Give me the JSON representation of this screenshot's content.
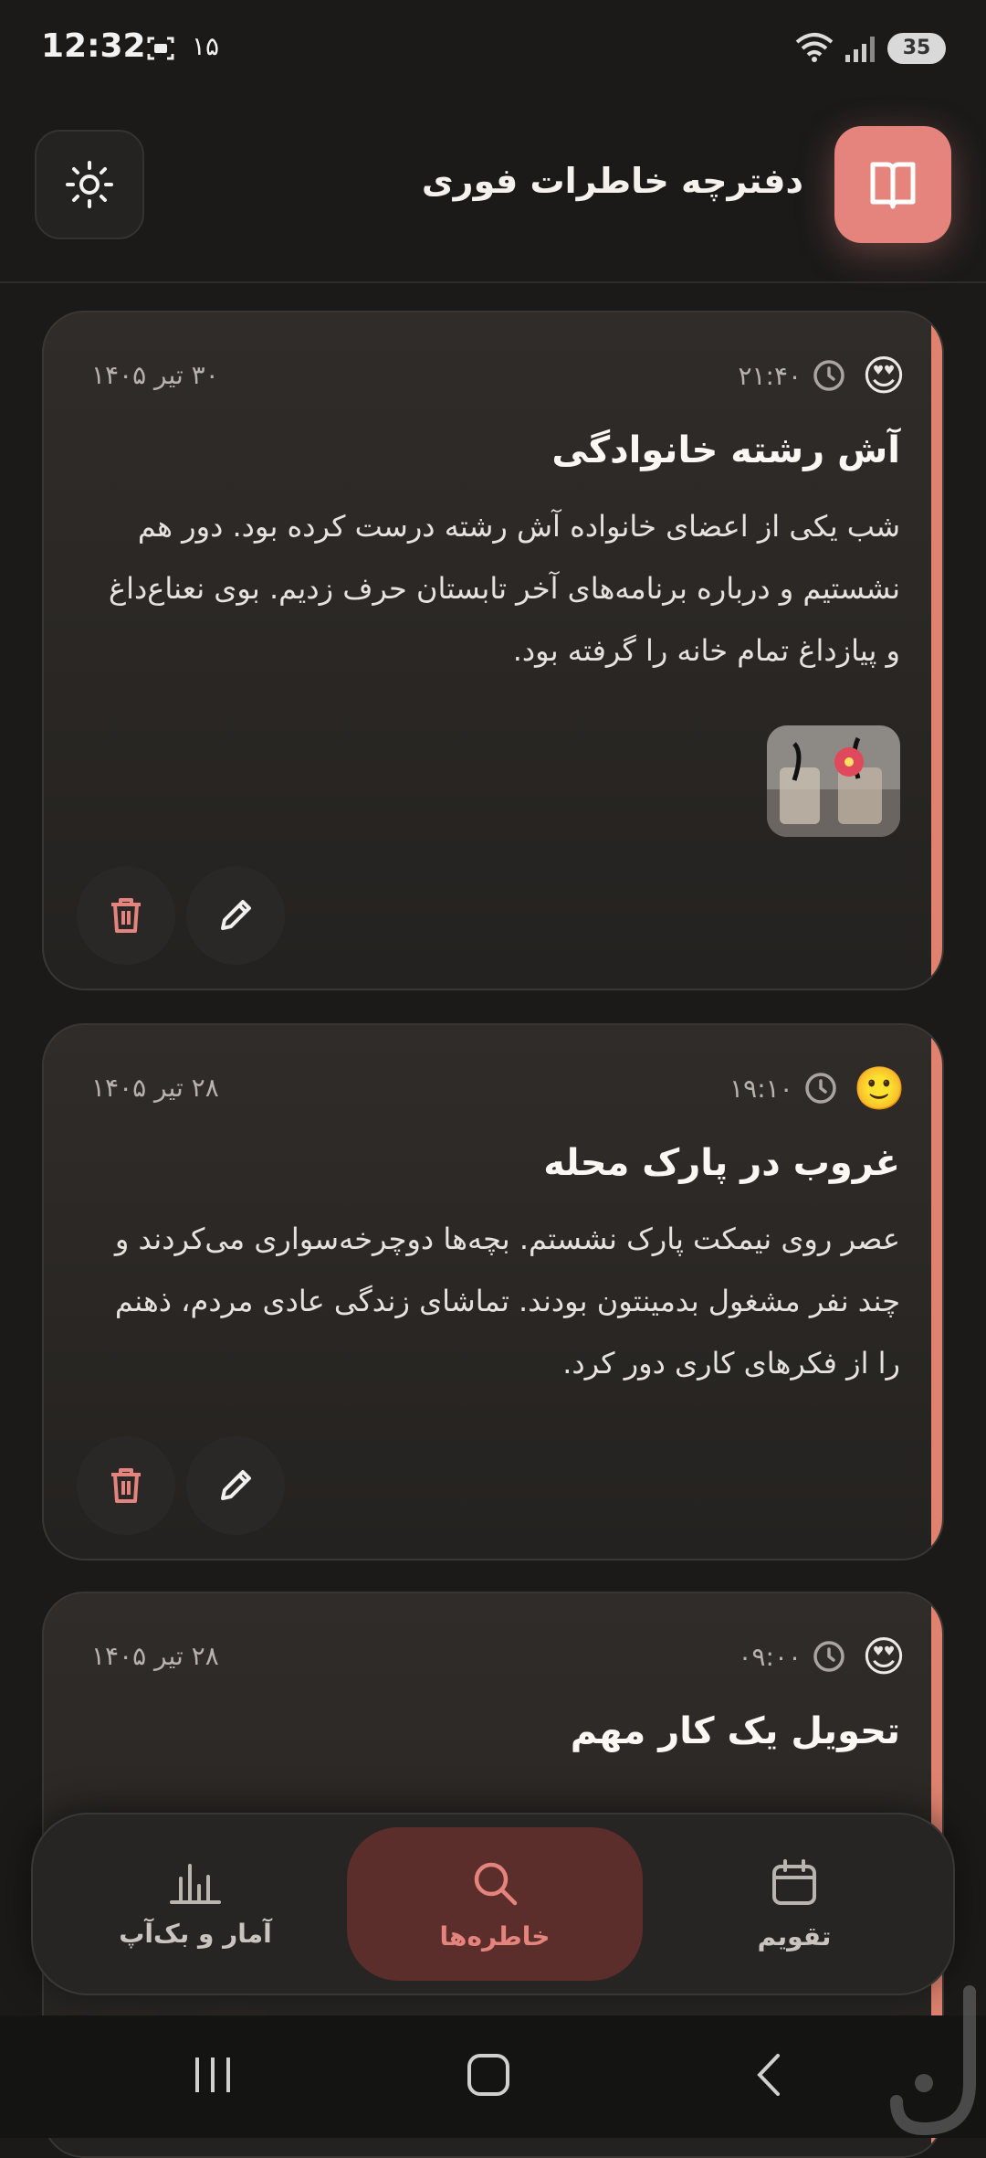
{
  "status_bar": {
    "time": "12:32",
    "notification_count": "۱۵",
    "battery": "35"
  },
  "header": {
    "title": "دفترچه خاطرات فوری",
    "theme_icon": "sun-icon",
    "logo_icon": "book-open-icon"
  },
  "colors": {
    "accent": "#e4847d",
    "card_stripe": "#e0826f",
    "nav_active_bg": "#5b2e2b",
    "background": "#1b1a19"
  },
  "entries": [
    {
      "date": "۳۰ تیر ۱۴۰۵",
      "time": "۲۱:۴۰",
      "mood": "😍",
      "title": "آش رشته خانوادگی",
      "body": "شب یکی از اعضای خانواده آش رشته درست کرده بود. دور هم نشستیم و درباره برنامه‌های آخر تابستان حرف زدیم. بوی نعناع‌داغ و پیازداغ تمام خانه را گرفته بود.",
      "has_photo": true
    },
    {
      "date": "۲۸ تیر ۱۴۰۵",
      "time": "۱۹:۱۰",
      "mood": "🙂",
      "title": "غروب در پارک محله",
      "body": "عصر روی نیمکت پارک نشستم. بچه‌ها دوچرخه‌سواری می‌کردند و چند نفر مشغول بدمینتون بودند. تماشای زندگی عادی مردم، ذهنم را از فکرهای کاری دور کرد.",
      "has_photo": false
    },
    {
      "date": "۲۸ تیر ۱۴۰۵",
      "time": "۰۹:۰۰",
      "mood": "😍",
      "title": "تحویل یک کار مهم",
      "body": "",
      "has_photo": false
    }
  ],
  "bottom_nav": {
    "items": [
      {
        "label": "آمار و بک‌آپ",
        "icon": "bar-chart-icon",
        "active": false
      },
      {
        "label": "خاطره‌ها",
        "icon": "search-icon",
        "active": true
      },
      {
        "label": "تقویم",
        "icon": "calendar-icon",
        "active": false
      }
    ]
  }
}
